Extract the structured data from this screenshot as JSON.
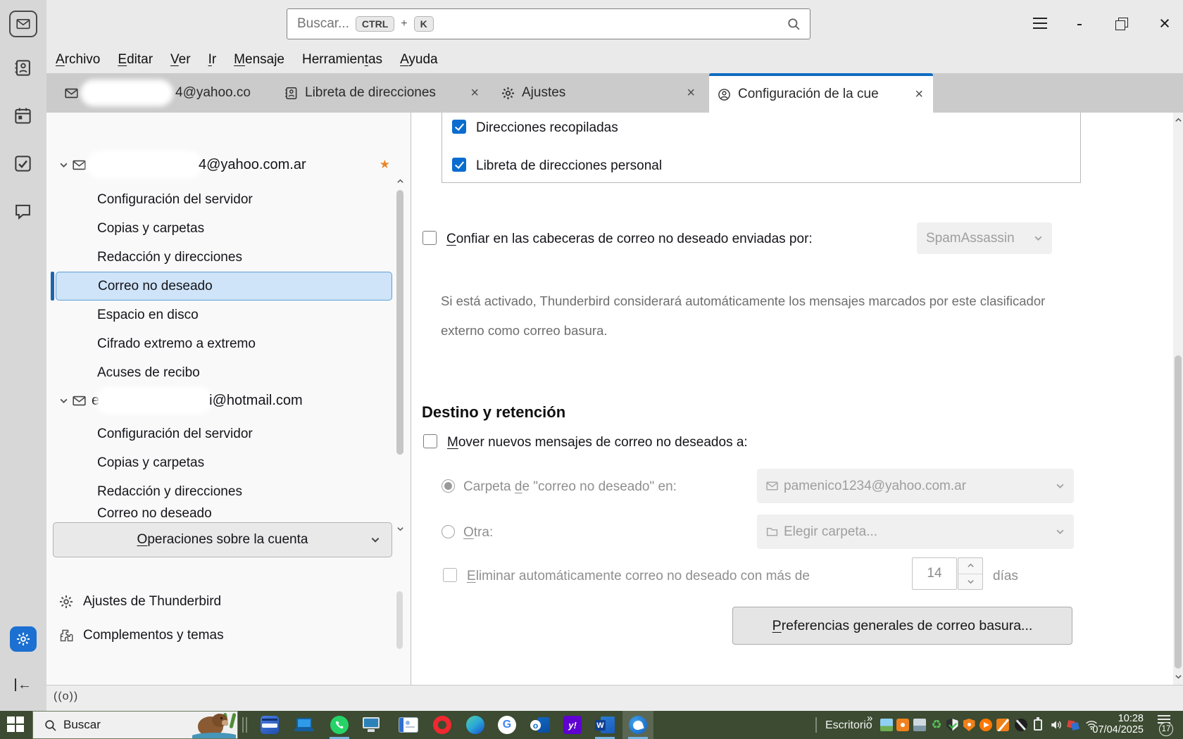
{
  "icons": {
    "star": "★",
    "back_arrow": "←",
    "close": "×"
  },
  "titlebar": {
    "search_placeholder": "Buscar...",
    "key_ctrl": "CTRL",
    "key_plus": "+",
    "key_k": "K"
  },
  "menubar": {
    "items": [
      {
        "pre": "",
        "key": "A",
        "post": "rchivo"
      },
      {
        "pre": "",
        "key": "E",
        "post": "ditar"
      },
      {
        "pre": "",
        "key": "V",
        "post": "er"
      },
      {
        "pre": "",
        "key": "I",
        "post": "r"
      },
      {
        "pre": "",
        "key": "M",
        "post": "ensaje"
      },
      {
        "pre": "Herramien",
        "key": "t",
        "post": "as"
      },
      {
        "pre": "",
        "key": "A",
        "post": "yuda"
      }
    ]
  },
  "tabs": {
    "mail": {
      "visible_text": "4@yahoo.co"
    },
    "address_book": {
      "label": "Libreta de direcciones"
    },
    "settings": {
      "label": "Ajustes"
    },
    "account_settings": {
      "label": "Configuración de la cue"
    }
  },
  "sidebar": {
    "yahoo": {
      "visible_suffix": "4@yahoo.com.ar",
      "items": [
        "Configuración del servidor",
        "Copias y carpetas",
        "Redacción y direcciones",
        "Correo no deseado",
        "Espacio en disco",
        "Cifrado extremo a extremo",
        "Acuses de recibo"
      ],
      "selected_item": "Correo no deseado"
    },
    "hotmail": {
      "visible_prefix": "e",
      "visible_suffix": "i@hotmail.com",
      "items": [
        "Configuración del servidor",
        "Copias y carpetas",
        "Redacción y direcciones",
        "Correo no deseado"
      ]
    },
    "operations": {
      "pre": "",
      "key": "O",
      "post": "peraciones sobre la cuenta"
    },
    "thunderbird_settings": "Ajustes de Thunderbird",
    "addons": "Complementos y temas"
  },
  "content": {
    "allowlist": [
      {
        "label": "Direcciones recopiladas",
        "checked": true
      },
      {
        "label": "Libreta de direcciones personal",
        "checked": true
      }
    ],
    "trust_label": {
      "pre": "",
      "key": "C",
      "post": "onfiar en las cabeceras de correo no deseado enviadas por:"
    },
    "trust_dropdown": "SpamAssassin",
    "trust_note": "Si está activado, Thunderbird considerará automáticamente los mensajes marcados por este clasificador externo como correo basura.",
    "section_title": "Destino y retención",
    "move_label": {
      "pre": "",
      "key": "M",
      "post": "over nuevos mensajes de correo no deseados a:"
    },
    "folder_label": {
      "pre": "Carpeta ",
      "key": "d",
      "post": "e \"correo no deseado\" en:"
    },
    "folder_dropdown": "pamenico1234@yahoo.com.ar",
    "other_label": {
      "pre": "",
      "key": "O",
      "post": "tra:"
    },
    "other_dropdown": "Elegir carpeta...",
    "retention_label": {
      "pre": "",
      "key": "E",
      "post": "liminar automáticamente correo no deseado con más de"
    },
    "retention_value": "14",
    "retention_suffix": "días",
    "prefs_button": {
      "pre": "",
      "key": "P",
      "post": "referencias generales de correo basura..."
    }
  },
  "statusbar": {
    "status_icon_text": "((o))"
  },
  "taskbar": {
    "search_label": "Buscar",
    "desktop_label": "Escritorio",
    "tray_overflow": "»",
    "time": "10:28",
    "date": "07/04/2025",
    "notification_count": "17",
    "glyphs": {
      "google": "G",
      "outlook": "o",
      "yahoo": "y!",
      "word": "W"
    }
  }
}
